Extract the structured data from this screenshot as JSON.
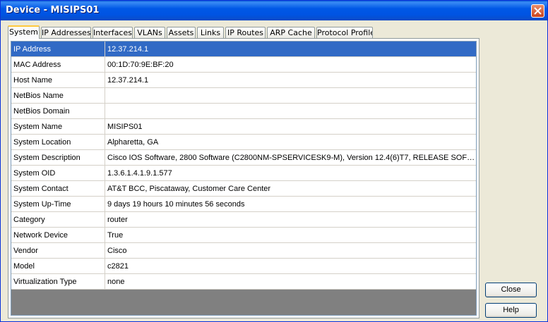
{
  "window": {
    "title": "Device - MISIPS01"
  },
  "tabs": [
    {
      "label": "System",
      "active": true
    },
    {
      "label": "IP Addresses"
    },
    {
      "label": "Interfaces"
    },
    {
      "label": "VLANs"
    },
    {
      "label": "Assets"
    },
    {
      "label": "Links"
    },
    {
      "label": "IP Routes"
    },
    {
      "label": "ARP Cache"
    },
    {
      "label": "Protocol Profile"
    }
  ],
  "rows": [
    {
      "key": "IP Address",
      "value": "12.37.214.1",
      "selected": true
    },
    {
      "key": "MAC Address",
      "value": "00:1D:70:9E:BF:20"
    },
    {
      "key": "Host Name",
      "value": "12.37.214.1"
    },
    {
      "key": "NetBios Name",
      "value": ""
    },
    {
      "key": "NetBios Domain",
      "value": ""
    },
    {
      "key": "System Name",
      "value": "MISIPS01"
    },
    {
      "key": "System Location",
      "value": "Alpharetta, GA"
    },
    {
      "key": "System Description",
      "value": "Cisco IOS Software, 2800 Software (C2800NM-SPSERVICESK9-M), Version 12.4(6)T7, RELEASE SOFTW..."
    },
    {
      "key": "System OID",
      "value": "1.3.6.1.4.1.9.1.577"
    },
    {
      "key": "System Contact",
      "value": "AT&T BCC, Piscataway, Customer Care Center"
    },
    {
      "key": "System Up-Time",
      "value": "9 days 19 hours 10 minutes 56 seconds"
    },
    {
      "key": "Category",
      "value": "router"
    },
    {
      "key": "Network Device",
      "value": "True"
    },
    {
      "key": "Vendor",
      "value": "Cisco"
    },
    {
      "key": "Model",
      "value": "c2821"
    },
    {
      "key": "Virtualization Type",
      "value": "none"
    }
  ],
  "buttons": {
    "close": "Close",
    "help": "Help"
  },
  "icons": {
    "window_close": "close-icon"
  },
  "colors": {
    "titlebar": "#0054e3",
    "selection": "#316ac5",
    "active_tab_accent": "#ffc83c"
  }
}
